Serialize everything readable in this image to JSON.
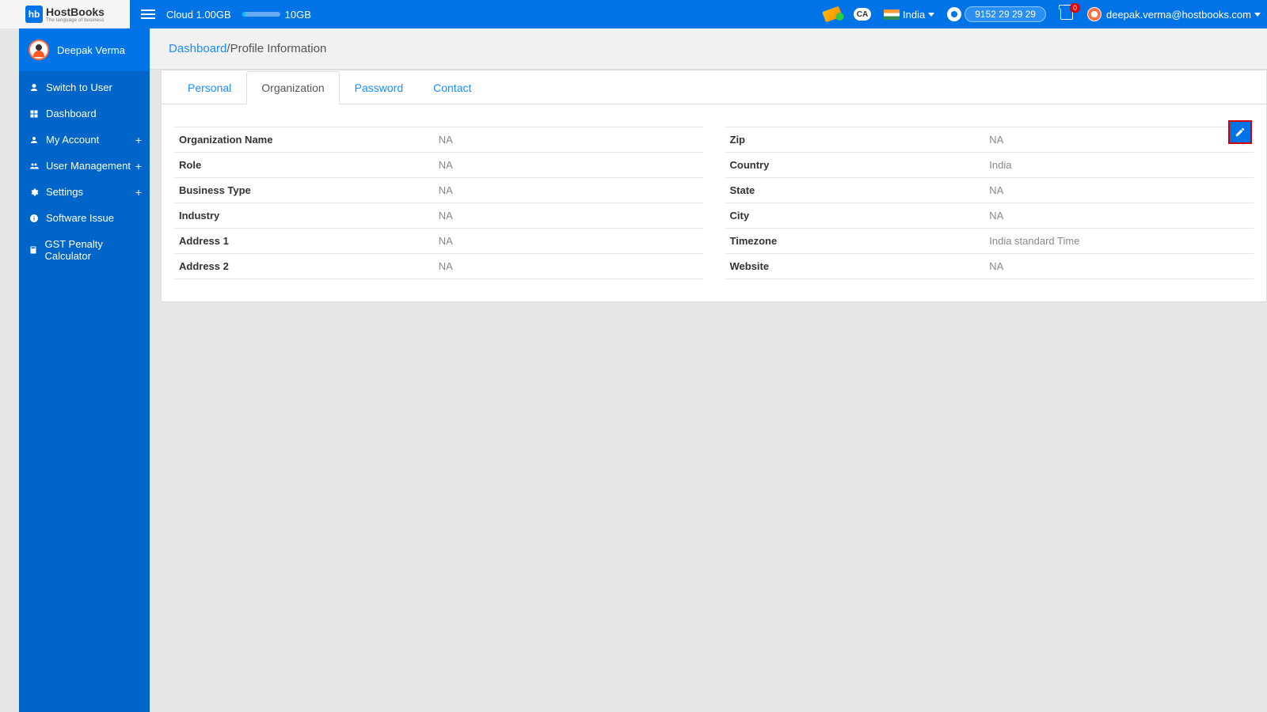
{
  "brand": {
    "hb": "hb",
    "name": "HostBooks",
    "tagline": "The language of business"
  },
  "topbar": {
    "cloud_label": "Cloud 1.00GB",
    "cloud_total": "10GB",
    "country": "India",
    "phone": "9152 29 29 29",
    "cart_count": "0",
    "user_email": "deepak.verma@hostbooks.com"
  },
  "sidebar": {
    "user_name": "Deepak Verma",
    "items": [
      {
        "label": "Switch to User",
        "icon": "user",
        "expandable": false
      },
      {
        "label": "Dashboard",
        "icon": "dashboard",
        "expandable": false
      },
      {
        "label": "My Account",
        "icon": "account",
        "expandable": true
      },
      {
        "label": "User Management",
        "icon": "users",
        "expandable": true
      },
      {
        "label": "Settings",
        "icon": "gear",
        "expandable": true
      },
      {
        "label": "Software Issue",
        "icon": "info",
        "expandable": false
      },
      {
        "label": "GST Penalty Calculator",
        "icon": "calculator",
        "expandable": false
      }
    ]
  },
  "breadcrumb": {
    "root": "Dashboard",
    "sep": " / ",
    "current": "Profile Information"
  },
  "tabs": [
    {
      "label": "Personal",
      "active": false
    },
    {
      "label": "Organization",
      "active": true
    },
    {
      "label": "Password",
      "active": false
    },
    {
      "label": "Contact",
      "active": false
    }
  ],
  "org_left": [
    {
      "k": "Organization Name",
      "v": "NA"
    },
    {
      "k": "Role",
      "v": "NA"
    },
    {
      "k": "Business Type",
      "v": "NA"
    },
    {
      "k": "Industry",
      "v": "NA"
    },
    {
      "k": "Address 1",
      "v": "NA"
    },
    {
      "k": "Address 2",
      "v": "NA"
    }
  ],
  "org_right": [
    {
      "k": "Zip",
      "v": "NA"
    },
    {
      "k": "Country",
      "v": "India"
    },
    {
      "k": "State",
      "v": "NA"
    },
    {
      "k": "City",
      "v": "NA"
    },
    {
      "k": "Timezone",
      "v": "India standard Time"
    },
    {
      "k": "Website",
      "v": "NA"
    }
  ]
}
